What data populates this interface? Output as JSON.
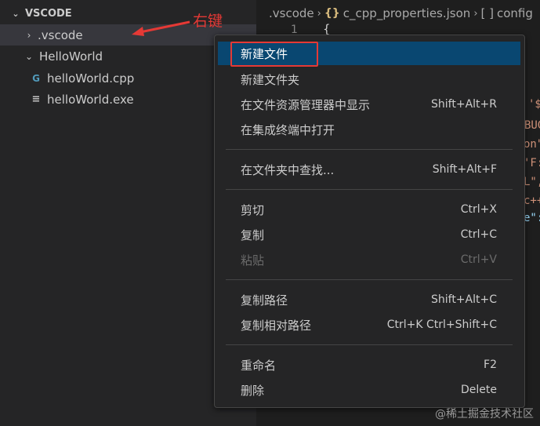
{
  "explorer": {
    "section_title": "VSCODE",
    "items": [
      {
        "label": ".vscode",
        "chevron": "›",
        "kind": "folder-collapsed"
      },
      {
        "label": "HelloWorld",
        "chevron": "⌄",
        "kind": "folder-expanded"
      },
      {
        "label": "helloWorld.cpp",
        "icon": "cpp-file-icon",
        "icon_glyph": "G"
      },
      {
        "label": "helloWorld.exe",
        "icon": "exe-file-icon",
        "icon_glyph": "≡"
      }
    ]
  },
  "annotation": {
    "label": "右键",
    "color": "#e53935"
  },
  "breadcrumb": {
    "folder": ".vscode",
    "file": "c_cpp_properties.json",
    "file_icon_glyph": "{}",
    "symbol_glyph": "[ ]",
    "symbol": "config"
  },
  "editor": {
    "line_number": "1",
    "line1_text": "{",
    "fragments": [
      {
        "text": "'${",
        "color": "#ce9178"
      },
      {
        "text": "BUG",
        "color": "#ce9178"
      },
      {
        "text": "on\"",
        "color": "#ce9178"
      },
      {
        "text": "'F:",
        "color": "#ce9178"
      },
      {
        "text": "L\",",
        "color": "#ce9178"
      },
      {
        "text": "c++",
        "color": "#ce9178"
      },
      {
        "text": "e\":",
        "color": "#9cdcfe"
      }
    ]
  },
  "context_menu": {
    "items": [
      {
        "label": "新建文件",
        "shortcut": "",
        "state": "active"
      },
      {
        "label": "新建文件夹",
        "shortcut": "",
        "state": "normal"
      },
      {
        "label": "在文件资源管理器中显示",
        "shortcut": "Shift+Alt+R",
        "state": "normal"
      },
      {
        "label": "在集成终端中打开",
        "shortcut": "",
        "state": "normal"
      },
      {
        "label": "在文件夹中查找...",
        "shortcut": "Shift+Alt+F",
        "state": "normal"
      },
      {
        "label": "剪切",
        "shortcut": "Ctrl+X",
        "state": "normal"
      },
      {
        "label": "复制",
        "shortcut": "Ctrl+C",
        "state": "normal"
      },
      {
        "label": "粘贴",
        "shortcut": "Ctrl+V",
        "state": "disabled"
      },
      {
        "label": "复制路径",
        "shortcut": "Shift+Alt+C",
        "state": "normal"
      },
      {
        "label": "复制相对路径",
        "shortcut": "Ctrl+K Ctrl+Shift+C",
        "state": "normal"
      },
      {
        "label": "重命名",
        "shortcut": "F2",
        "state": "normal"
      },
      {
        "label": "删除",
        "shortcut": "Delete",
        "state": "normal"
      }
    ]
  },
  "watermark": "@稀土掘金技术社区",
  "colors": {
    "accent_highlight": "#094771",
    "annotation_red": "#e53935",
    "sidebar_bg": "#252526",
    "editor_bg": "#1e1e1e"
  }
}
